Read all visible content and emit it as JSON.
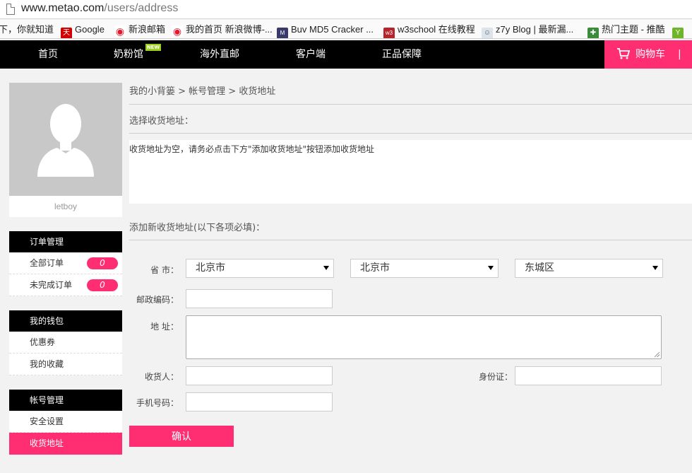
{
  "browser": {
    "url_host": "www.metao.com",
    "url_path": "/users/address",
    "bookmarks": [
      {
        "label": "下，你就知道",
        "icon": "none"
      },
      {
        "label": "Google",
        "icon": "tmall-icon",
        "color": "#d40000",
        "glyph": "天"
      },
      {
        "label": "新浪邮箱",
        "icon": "weibo-icon",
        "color": "#e6162d",
        "glyph": "◉"
      },
      {
        "label": "我的首页 新浪微博-...",
        "icon": "weibo-icon",
        "color": "#e6162d",
        "glyph": "◉"
      },
      {
        "label": "Buv MD5 Cracker ...",
        "icon": "md5-icon",
        "color": "#3a3a6a",
        "glyph": "M"
      },
      {
        "label": "w3school 在线教程",
        "icon": "w3school-icon",
        "color": "#b5242a",
        "glyph": "w3"
      },
      {
        "label": "z7y Blog | 最新漏...",
        "icon": "blog-icon",
        "color": "#6b7a8c",
        "glyph": "☺"
      },
      {
        "label": "热门主题 - 推酷",
        "icon": "tuicool-icon",
        "color": "#3b8b3b",
        "glyph": "✚"
      },
      {
        "label": "Y",
        "icon": "y-icon",
        "color": "#6fb52c",
        "glyph": "Y"
      }
    ]
  },
  "nav": {
    "items": [
      "首页",
      "奶粉馆",
      "海外直邮",
      "客户端",
      "正品保障"
    ],
    "new_badge": "NEW",
    "cart_label": "购物车",
    "cart_sep": "|",
    "accent": "#ff2e73"
  },
  "sidebar": {
    "username": "letboy",
    "sections": [
      {
        "title": "订单管理",
        "items": [
          {
            "label": "全部订单",
            "count": "0"
          },
          {
            "label": "未完成订单",
            "count": "0"
          }
        ]
      },
      {
        "title": "我的钱包",
        "items": [
          {
            "label": "优惠券"
          },
          {
            "label": "我的收藏"
          }
        ]
      },
      {
        "title": "帐号管理",
        "items": [
          {
            "label": "安全设置"
          },
          {
            "label": "收货地址",
            "active": true
          }
        ]
      }
    ]
  },
  "main": {
    "breadcrumb": "我的小背篓 > 帐号管理 > 收货地址",
    "select_title": "选择收货地址：",
    "empty_message": "收货地址为空，请务必点击下方\"添加收货地址\"按钮添加收货地址",
    "add_title": "添加新收货地址(以下各项必填)：",
    "form": {
      "province_label": "省  市：",
      "province": "北京市",
      "city": "北京市",
      "district": "东城区",
      "postcode_label": "邮政编码：",
      "address_label": "地  址：",
      "receiver_label": "收货人：",
      "id_label": "身份证：",
      "phone_label": "手机号码：",
      "submit_label": "确认"
    }
  }
}
